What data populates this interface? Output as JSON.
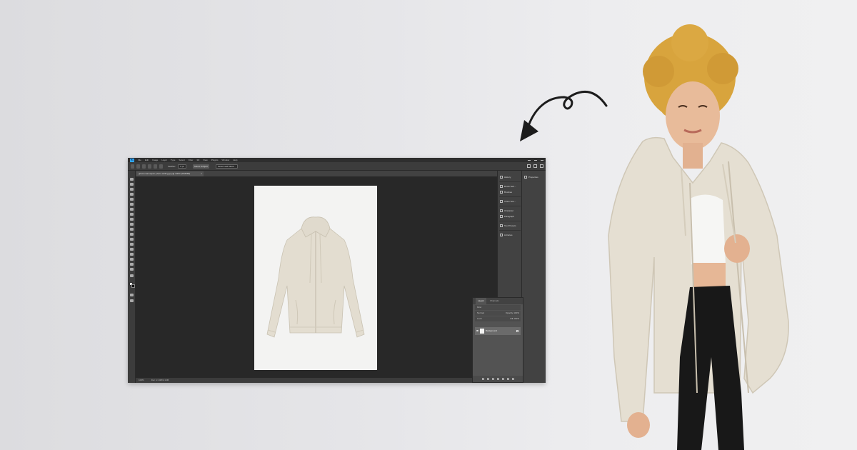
{
  "app": {
    "menu": [
      "File",
      "Edit",
      "Image",
      "Layer",
      "Type",
      "Select",
      "Filter",
      "3D",
      "View",
      "Plugins",
      "Window",
      "Help"
    ],
    "options": {
      "feather_label": "Feather:",
      "feather_value": "0 px",
      "select_subject": "Select Subject",
      "select_mask": "Select and Mask..."
    },
    "document_tab": "ghost-mannequin-photo-editing.jpg @ 100% (RGB/8#)",
    "status": {
      "zoom": "100%",
      "doc_size": "Doc: 2.14M/2.14M"
    },
    "dock": [
      {
        "icon": "history-icon",
        "label": "History"
      },
      {
        "icon": "brush-settings-icon",
        "label": "Brush Sett..."
      },
      {
        "icon": "brushes-icon",
        "label": "Brushes"
      },
      {
        "icon": "clone-source-icon",
        "label": "Clone Sou..."
      },
      {
        "icon": "character-icon",
        "label": "Character"
      },
      {
        "icon": "paragraph-icon",
        "label": "Paragraph"
      },
      {
        "icon": "tool-presets-icon",
        "label": "Tool Presets"
      },
      {
        "icon": "libraries-icon",
        "label": "Libraries"
      }
    ],
    "properties_label": "Properties",
    "layers": {
      "tabs": [
        "Layers",
        "Channels"
      ],
      "kind": "Kind",
      "mode": "Normal",
      "opacity_label": "Opacity:",
      "opacity": "100%",
      "lock_label": "Lock:",
      "fill_label": "Fill:",
      "fill": "100%",
      "layer_name": "Background"
    }
  },
  "colors": {
    "accent": "#31a8ff",
    "canvas": "#282828",
    "panel": "#535353",
    "hoodie": "#e2dccf"
  }
}
